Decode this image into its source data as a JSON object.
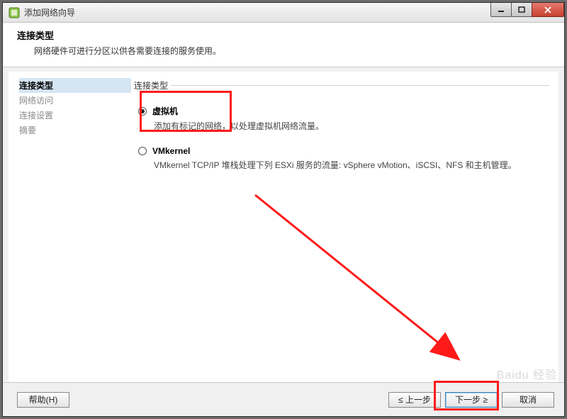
{
  "window": {
    "title": "添加网络向导"
  },
  "header": {
    "title": "连接类型",
    "description": "网络硬件可进行分区以供各需要连接的服务使用。"
  },
  "sidebar": {
    "steps": [
      {
        "label": "连接类型",
        "active": true
      },
      {
        "label": "网络访问",
        "active": false
      },
      {
        "label": "连接设置",
        "active": false
      },
      {
        "label": "摘要",
        "active": false
      }
    ]
  },
  "content": {
    "fieldset_legend": "连接类型",
    "options": [
      {
        "key": "vm",
        "label": "虚拟机",
        "description": "添加有标记的网络，以处理虚拟机网络流量。",
        "selected": true
      },
      {
        "key": "vmkernel",
        "label": "VMkernel",
        "description": "VMkernel TCP/IP 堆栈处理下列 ESXi 服务的流量: vSphere vMotion、iSCSI、NFS 和主机管理。",
        "selected": false
      }
    ]
  },
  "buttons": {
    "help": "帮助(H)",
    "back": "≤ 上一步",
    "next": "下一步 ≥",
    "cancel": "取消"
  },
  "watermark": "Baidu 经验"
}
